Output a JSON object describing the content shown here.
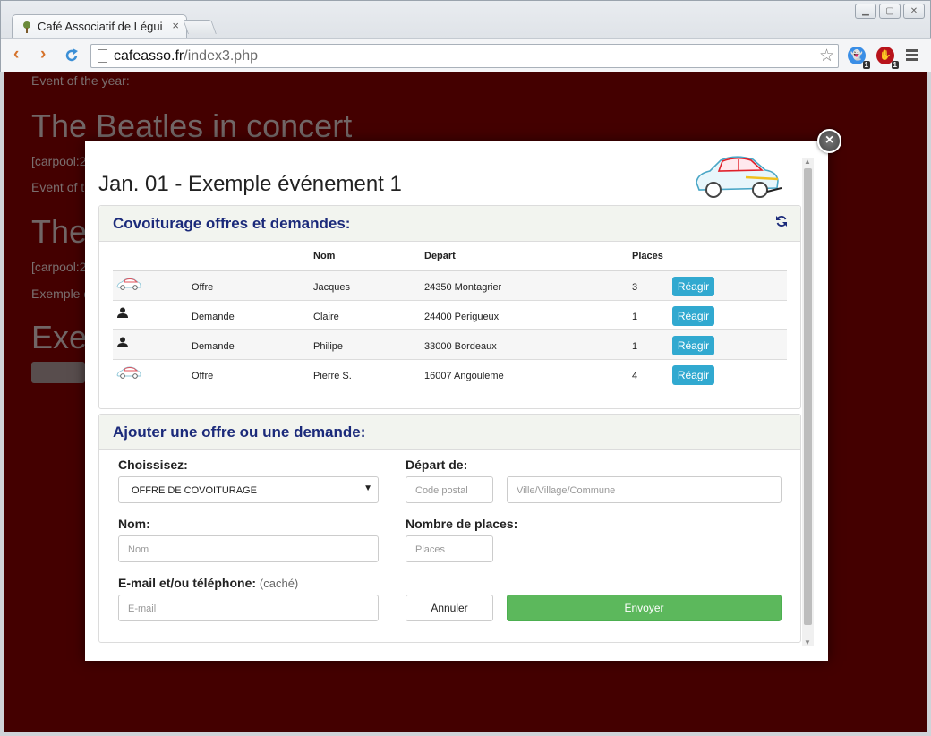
{
  "browser": {
    "tab_title": "Café Associatif de Légui",
    "tab_close": "×",
    "url_host": "cafeasso.fr",
    "url_path": "/index3.php",
    "ext_badge_1": "1",
    "ext_badge_2": "1"
  },
  "background": {
    "line1": "Event of the year:",
    "heading1": "The Beatles in concert",
    "line2": "[carpool:2",
    "line3": "Event of t",
    "heading2": "The",
    "line4": "[carpool:2",
    "line5": "Exemple d",
    "heading3": "Exe"
  },
  "modal": {
    "close_label": "×",
    "title": "Jan. 01 - Exemple événement 1",
    "carpool_panel": {
      "heading": "Covoiturage offres et demandes:",
      "columns": [
        "",
        "",
        "Nom",
        "Depart",
        "Places"
      ],
      "rows": [
        {
          "icon": "car-icon",
          "type": "Offre",
          "nom": "Jacques",
          "depart": "24350 Montagrier",
          "places": "3",
          "action": "Réagir"
        },
        {
          "icon": "person-icon",
          "type": "Demande",
          "nom": "Claire",
          "depart": "24400 Perigueux",
          "places": "1",
          "action": "Réagir"
        },
        {
          "icon": "person-icon",
          "type": "Demande",
          "nom": "Philipe",
          "depart": "33000 Bordeaux",
          "places": "1",
          "action": "Réagir"
        },
        {
          "icon": "car-icon",
          "type": "Offre",
          "nom": "Pierre S.",
          "depart": "16007 Angouleme",
          "places": "4",
          "action": "Réagir"
        }
      ]
    },
    "form_panel": {
      "heading": "Ajouter une offre ou une demande:",
      "choose_label": "Choissisez:",
      "choose_value": "OFFRE DE COVOITURAGE",
      "depart_label": "Départ de:",
      "postal_placeholder": "Code postal",
      "town_placeholder": "Ville/Village/Commune",
      "name_label": "Nom:",
      "name_placeholder": "Nom",
      "places_label": "Nombre de places:",
      "places_placeholder": "Places",
      "contact_label": "E-mail et/ou téléphone:",
      "contact_hint": "(caché)",
      "email_placeholder": "E-mail",
      "cancel_label": "Annuler",
      "send_label": "Envoyer"
    }
  },
  "colors": {
    "page_bg": "#4f0000",
    "heading_blue": "#1b2a7a",
    "reagir_blue": "#31a9d0",
    "send_green": "#5cb85c"
  }
}
